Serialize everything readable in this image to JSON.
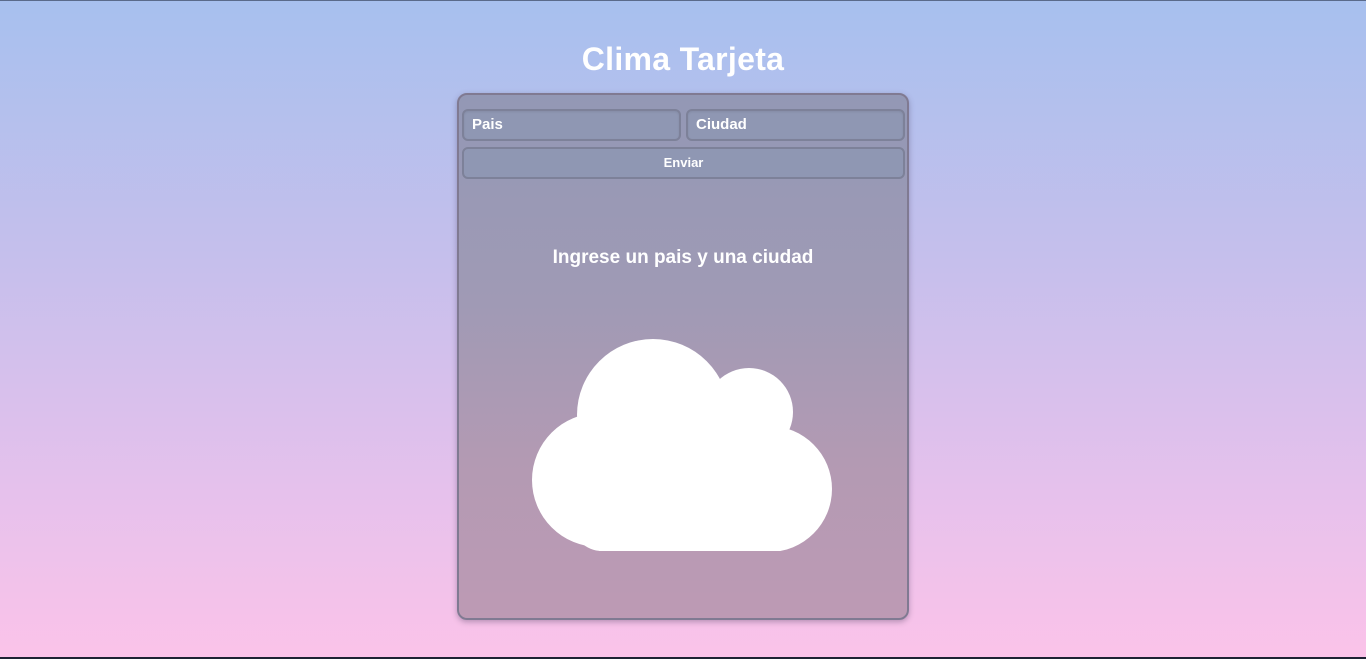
{
  "header": {
    "title": "Clima Tarjeta"
  },
  "form": {
    "pais_placeholder": "Pais",
    "ciudad_placeholder": "Ciudad",
    "send_label": "Enviar"
  },
  "result": {
    "message": "Ingrese un pais y una ciudad",
    "icon": "cloud-icon"
  },
  "colors": {
    "text": "#ffffff",
    "card": "#a09ab5",
    "bg_top": "#a7c0ee",
    "bg_bottom": "#fbc3e9"
  }
}
